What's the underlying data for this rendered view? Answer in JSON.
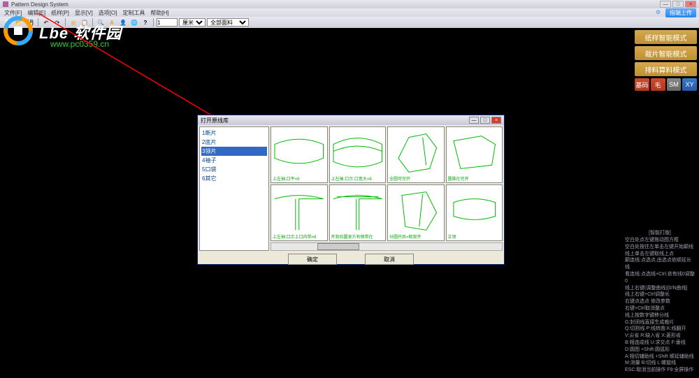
{
  "app": {
    "title": "Pattern Design System"
  },
  "watermark": {
    "site_name": "Lbe 软件园",
    "site_url": "www.pc0359.cn"
  },
  "menubar": {
    "items": [
      "文件[F]",
      "编辑[E]",
      "纸样[P]",
      "显示[V]",
      "选项[O]",
      "定制工具",
      "帮助[H]"
    ],
    "upload": "指端上传"
  },
  "toolbar": {
    "value_input": "1",
    "unit": "厘米",
    "layer": "全部面料"
  },
  "right_panel": {
    "modes": [
      "纸样智能模式",
      "裁片智能模式",
      "排料算料模式"
    ],
    "small": [
      "基码",
      "毛",
      "SM",
      "XY"
    ]
  },
  "dialog": {
    "title": "打开原线库",
    "list": [
      "1断片",
      "2底片",
      "3领片",
      "4袖子",
      "5口袋",
      "6其它"
    ],
    "selected_index": 2,
    "thumbs": [
      "上左袖:口平=8",
      "上左袖:口示:口宽大=8",
      "全圆可完开",
      "圆锥在完开",
      "上左袖:口示上口内带=8",
      "开背后圆发方有侧带在",
      "分圆开后=取双开",
      "立领"
    ],
    "ok": "确定",
    "cancel": "取消"
  },
  "help": {
    "title": "[智能打版]",
    "lines": [
      "空白处点左键拖动图方框",
      "空白处按住左单击左键开始颠线",
      "线上单击左键取线上点",
      "颠连线:点选点,由选点依顺延长线",
      "看连线:点选线+Ctrl,依有线0调整0",
      "线上右键(调整曲线)[0/N曲线]",
      "线上右键+Ctrl调整长",
      "右键点选点 修改参数",
      "右键+Ctrl取消整点",
      "线上按数字键移分线",
      "G:封闭线直接生成裁片",
      "Q:切割线 P:线转曲 K:线翻开",
      "V:尖省 R:缺入省 X:菱形省",
      "B:相连成线 U:求交点 F:垂线",
      "D:圆图 +Shift:圆弧形",
      "A:相切辅助线 +Shift 顺延辅助线",
      "M:测量 B:切线 L:螺旋线",
      "ESC:取消当前操作 F9:全屏操作"
    ]
  }
}
